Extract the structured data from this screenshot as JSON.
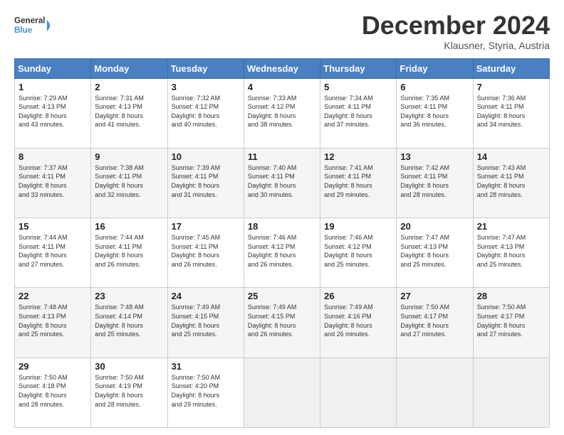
{
  "logo": {
    "line1": "General",
    "line2": "Blue"
  },
  "title": "December 2024",
  "subtitle": "Klausner, Styria, Austria",
  "days_of_week": [
    "Sunday",
    "Monday",
    "Tuesday",
    "Wednesday",
    "Thursday",
    "Friday",
    "Saturday"
  ],
  "weeks": [
    [
      {
        "day": "1",
        "info": "Sunrise: 7:29 AM\nSunset: 4:13 PM\nDaylight: 8 hours\nand 43 minutes."
      },
      {
        "day": "2",
        "info": "Sunrise: 7:31 AM\nSunset: 4:13 PM\nDaylight: 8 hours\nand 41 minutes."
      },
      {
        "day": "3",
        "info": "Sunrise: 7:32 AM\nSunset: 4:12 PM\nDaylight: 8 hours\nand 40 minutes."
      },
      {
        "day": "4",
        "info": "Sunrise: 7:33 AM\nSunset: 4:12 PM\nDaylight: 8 hours\nand 38 minutes."
      },
      {
        "day": "5",
        "info": "Sunrise: 7:34 AM\nSunset: 4:11 PM\nDaylight: 8 hours\nand 37 minutes."
      },
      {
        "day": "6",
        "info": "Sunrise: 7:35 AM\nSunset: 4:11 PM\nDaylight: 8 hours\nand 36 minutes."
      },
      {
        "day": "7",
        "info": "Sunrise: 7:36 AM\nSunset: 4:11 PM\nDaylight: 8 hours\nand 34 minutes."
      }
    ],
    [
      {
        "day": "8",
        "info": "Sunrise: 7:37 AM\nSunset: 4:11 PM\nDaylight: 8 hours\nand 33 minutes."
      },
      {
        "day": "9",
        "info": "Sunrise: 7:38 AM\nSunset: 4:11 PM\nDaylight: 8 hours\nand 32 minutes."
      },
      {
        "day": "10",
        "info": "Sunrise: 7:39 AM\nSunset: 4:11 PM\nDaylight: 8 hours\nand 31 minutes."
      },
      {
        "day": "11",
        "info": "Sunrise: 7:40 AM\nSunset: 4:11 PM\nDaylight: 8 hours\nand 30 minutes."
      },
      {
        "day": "12",
        "info": "Sunrise: 7:41 AM\nSunset: 4:11 PM\nDaylight: 8 hours\nand 29 minutes."
      },
      {
        "day": "13",
        "info": "Sunrise: 7:42 AM\nSunset: 4:11 PM\nDaylight: 8 hours\nand 28 minutes."
      },
      {
        "day": "14",
        "info": "Sunrise: 7:43 AM\nSunset: 4:11 PM\nDaylight: 8 hours\nand 28 minutes."
      }
    ],
    [
      {
        "day": "15",
        "info": "Sunrise: 7:44 AM\nSunset: 4:11 PM\nDaylight: 8 hours\nand 27 minutes."
      },
      {
        "day": "16",
        "info": "Sunrise: 7:44 AM\nSunset: 4:11 PM\nDaylight: 8 hours\nand 26 minutes."
      },
      {
        "day": "17",
        "info": "Sunrise: 7:45 AM\nSunset: 4:11 PM\nDaylight: 8 hours\nand 26 minutes."
      },
      {
        "day": "18",
        "info": "Sunrise: 7:46 AM\nSunset: 4:12 PM\nDaylight: 8 hours\nand 26 minutes."
      },
      {
        "day": "19",
        "info": "Sunrise: 7:46 AM\nSunset: 4:12 PM\nDaylight: 8 hours\nand 25 minutes."
      },
      {
        "day": "20",
        "info": "Sunrise: 7:47 AM\nSunset: 4:13 PM\nDaylight: 8 hours\nand 25 minutes."
      },
      {
        "day": "21",
        "info": "Sunrise: 7:47 AM\nSunset: 4:13 PM\nDaylight: 8 hours\nand 25 minutes."
      }
    ],
    [
      {
        "day": "22",
        "info": "Sunrise: 7:48 AM\nSunset: 4:13 PM\nDaylight: 8 hours\nand 25 minutes."
      },
      {
        "day": "23",
        "info": "Sunrise: 7:48 AM\nSunset: 4:14 PM\nDaylight: 8 hours\nand 25 minutes."
      },
      {
        "day": "24",
        "info": "Sunrise: 7:49 AM\nSunset: 4:15 PM\nDaylight: 8 hours\nand 25 minutes."
      },
      {
        "day": "25",
        "info": "Sunrise: 7:49 AM\nSunset: 4:15 PM\nDaylight: 8 hours\nand 26 minutes."
      },
      {
        "day": "26",
        "info": "Sunrise: 7:49 AM\nSunset: 4:16 PM\nDaylight: 8 hours\nand 26 minutes."
      },
      {
        "day": "27",
        "info": "Sunrise: 7:50 AM\nSunset: 4:17 PM\nDaylight: 8 hours\nand 27 minutes."
      },
      {
        "day": "28",
        "info": "Sunrise: 7:50 AM\nSunset: 4:17 PM\nDaylight: 8 hours\nand 27 minutes."
      }
    ],
    [
      {
        "day": "29",
        "info": "Sunrise: 7:50 AM\nSunset: 4:18 PM\nDaylight: 8 hours\nand 28 minutes."
      },
      {
        "day": "30",
        "info": "Sunrise: 7:50 AM\nSunset: 4:19 PM\nDaylight: 8 hours\nand 28 minutes."
      },
      {
        "day": "31",
        "info": "Sunrise: 7:50 AM\nSunset: 4:20 PM\nDaylight: 8 hours\nand 29 minutes."
      },
      null,
      null,
      null,
      null
    ]
  ]
}
